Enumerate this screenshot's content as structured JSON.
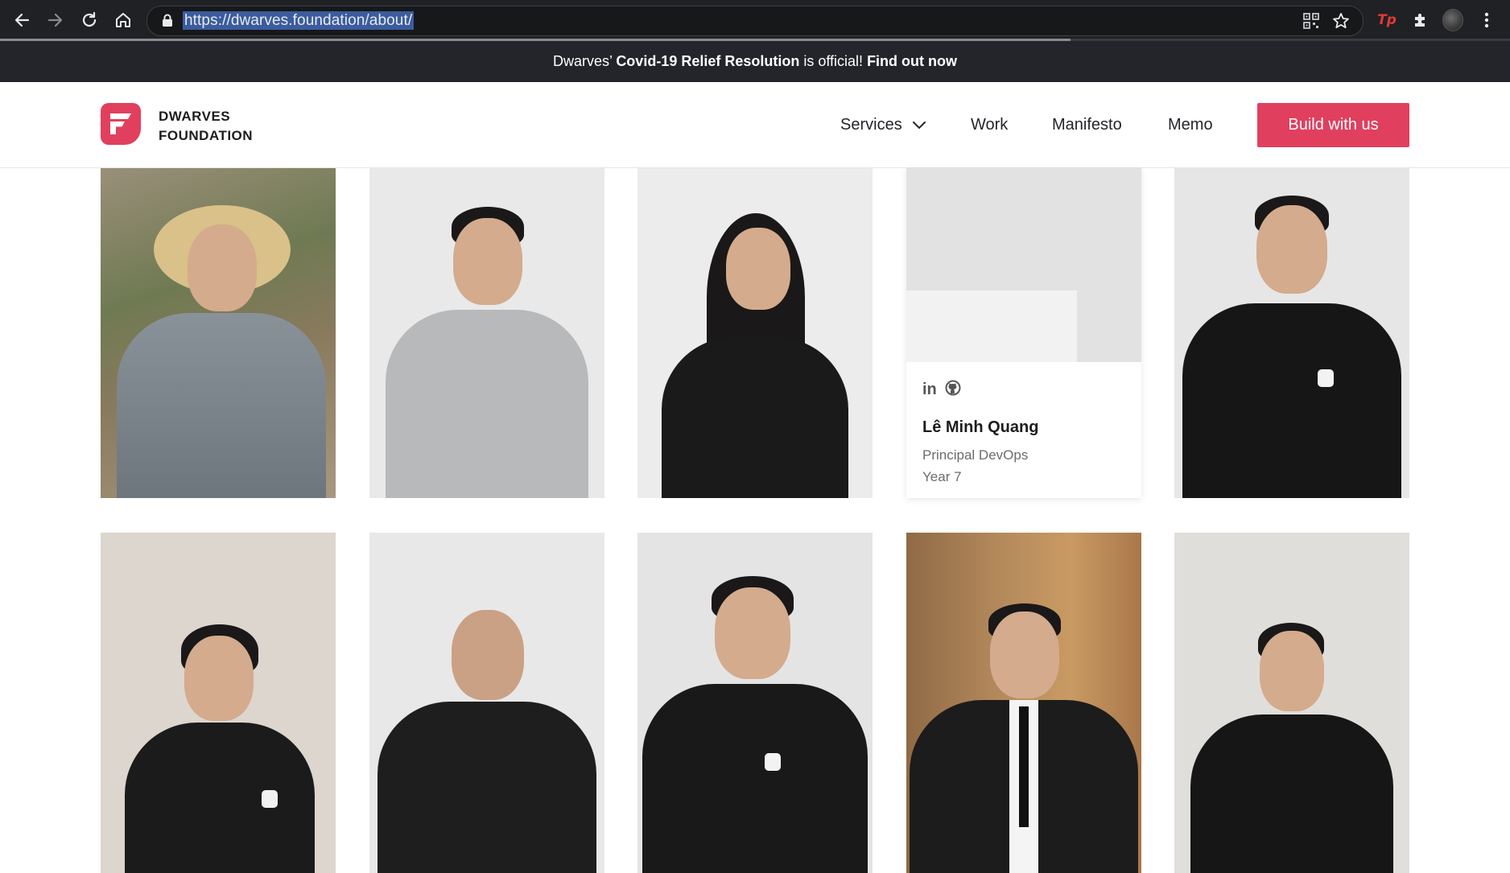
{
  "browser": {
    "url": "https://dwarves.foundation/about/"
  },
  "announcement": {
    "prefix": "Dwarves’ ",
    "highlight": "Covid-19 Relief Resolution",
    "middle": " is official! ",
    "link": "Find out now"
  },
  "header": {
    "logo_line1": "DWARVES",
    "logo_line2": "FOUNDATION",
    "brand_color": "#e13f5e",
    "nav": [
      {
        "label": "Services"
      },
      {
        "label": "Work"
      },
      {
        "label": "Manifesto"
      },
      {
        "label": "Memo"
      }
    ],
    "cta_label": "Build with us"
  },
  "team": {
    "highlighted_member": {
      "name": "Lê Minh Quang",
      "role": "Principal DevOps",
      "year": "Year 7"
    }
  },
  "icons": [
    "back-arrow-icon",
    "forward-arrow-icon",
    "reload-icon",
    "home-icon",
    "lock-icon",
    "qr-code-icon",
    "star-icon",
    "extension-icon",
    "puzzle-icon",
    "profile-avatar",
    "kebab-menu-icon",
    "chevron-down-icon",
    "linkedin-icon",
    "github-icon"
  ]
}
